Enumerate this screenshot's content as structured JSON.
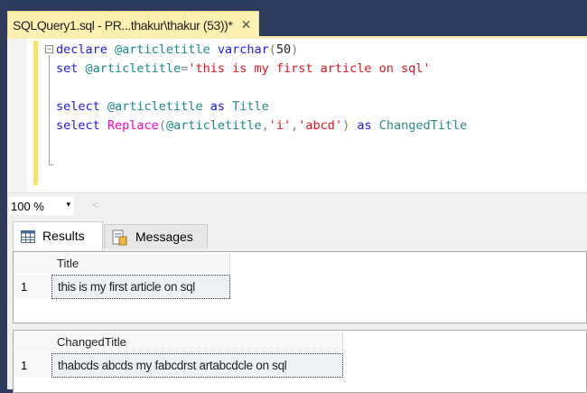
{
  "document_tab": {
    "title": "SQLQuery1.sql - PR...thakur\\thakur (53))*",
    "close": "✕"
  },
  "editor": {
    "fold_symbol": "−",
    "lines": [
      [
        {
          "t": "declare ",
          "c": "kw"
        },
        {
          "t": "@articletitle ",
          "c": "var"
        },
        {
          "t": "varchar",
          "c": "kw"
        },
        {
          "t": "(",
          "c": "gr"
        },
        {
          "t": "50",
          "c": "num"
        },
        {
          "t": ")",
          "c": "gr"
        }
      ],
      [
        {
          "t": "set ",
          "c": "kw"
        },
        {
          "t": "@articletitle",
          "c": "var"
        },
        {
          "t": "=",
          "c": "gr"
        },
        {
          "t": "'this is my first article on sql'",
          "c": "str"
        }
      ],
      [],
      [
        {
          "t": "select ",
          "c": "kw"
        },
        {
          "t": "@articletitle ",
          "c": "var"
        },
        {
          "t": "as ",
          "c": "kw"
        },
        {
          "t": "Title",
          "c": "id"
        }
      ],
      [
        {
          "t": "select ",
          "c": "kw"
        },
        {
          "t": "Replace",
          "c": "fn"
        },
        {
          "t": "(",
          "c": "gr"
        },
        {
          "t": "@articletitle",
          "c": "var"
        },
        {
          "t": ",",
          "c": "gr"
        },
        {
          "t": "'i'",
          "c": "str"
        },
        {
          "t": ",",
          "c": "gr"
        },
        {
          "t": "'abcd'",
          "c": "str"
        },
        {
          "t": ") ",
          "c": "gr"
        },
        {
          "t": "as ",
          "c": "kw"
        },
        {
          "t": "ChangedTitle",
          "c": "id"
        }
      ]
    ]
  },
  "zoom": {
    "value": "100 %",
    "dropdown": "▾",
    "scroll_left": "<"
  },
  "results_tabs": [
    {
      "label": "Results"
    },
    {
      "label": "Messages"
    }
  ],
  "grids": [
    {
      "header": "Title",
      "rows": [
        {
          "num": "1",
          "value": "this is my first article on sql"
        }
      ]
    },
    {
      "header": "ChangedTitle",
      "rows": [
        {
          "num": "1",
          "value": "thabcds abcds my fabcdrst artabcdcle on sql"
        }
      ]
    }
  ]
}
